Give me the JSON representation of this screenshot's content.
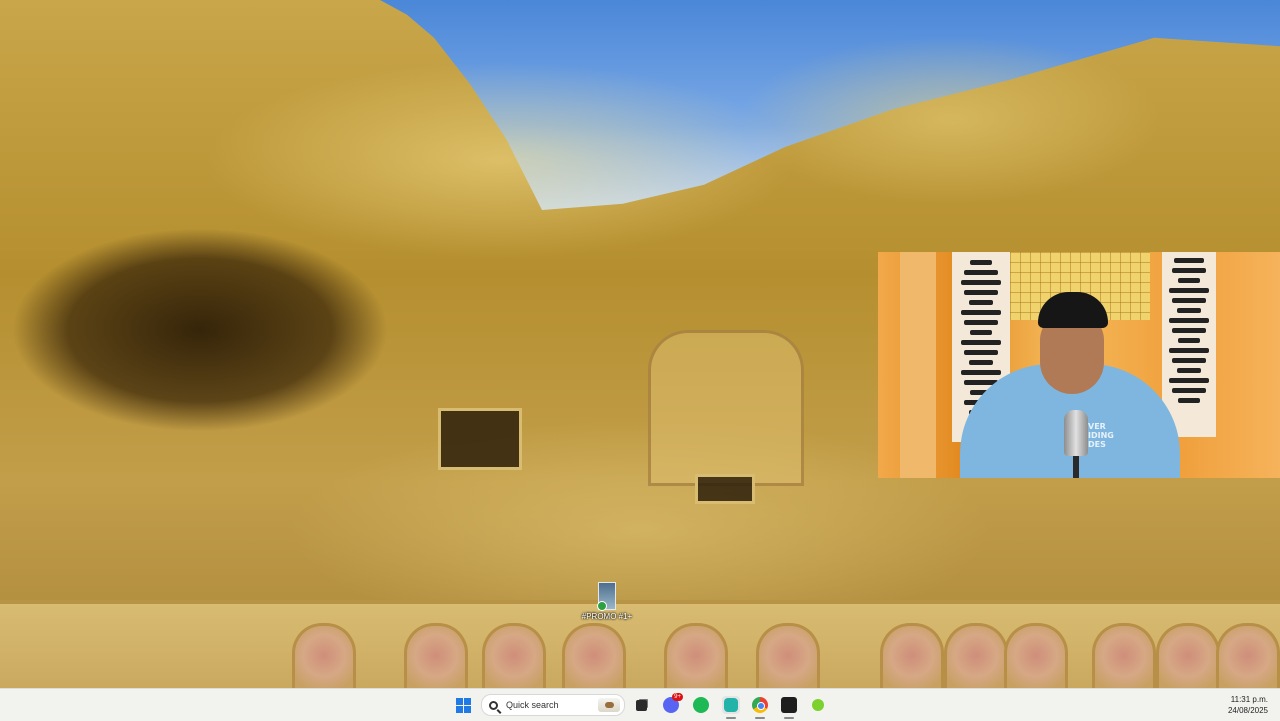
{
  "desktop": {
    "icon_label": "#PROMO #1+"
  },
  "taskbar": {
    "search_label": "Quick search",
    "apps": [
      {
        "name": "file-explorer",
        "color": "#2b2b2b"
      },
      {
        "name": "discord",
        "color": "#5865f2",
        "badge": "9+"
      },
      {
        "name": "spotify",
        "color": "#1db954"
      },
      {
        "name": "messenger-app",
        "color": "#24b3a8"
      },
      {
        "name": "chrome",
        "color": "#ea4335"
      },
      {
        "name": "obs-studio",
        "color": "#1e1e1e"
      },
      {
        "name": "green-app",
        "color": "#7bd12e"
      }
    ],
    "time": "11:31 p.m.",
    "date": "24/08/2025"
  },
  "webcam": {
    "shirt_text": "VER\nIDING\nDES"
  }
}
